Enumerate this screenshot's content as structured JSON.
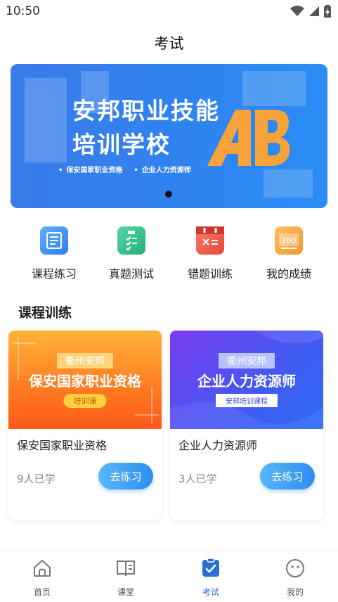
{
  "status_bar": {
    "time": "10:50"
  },
  "header": {
    "title": "考试"
  },
  "banner": {
    "title_line1": "安邦职业技能",
    "title_line2": "培训学校",
    "tags": [
      "保安国家职业资格",
      "企业人力资源师"
    ],
    "logo_icon": "ab-logo-icon"
  },
  "quick_actions": [
    {
      "label": "课程练习",
      "icon": "course-practice-icon",
      "color": "#3d8ef5"
    },
    {
      "label": "真题测试",
      "icon": "exam-checklist-icon",
      "color": "#2fc28a"
    },
    {
      "label": "错题训练",
      "icon": "wrong-question-calendar-icon",
      "color": "#ec5a4a"
    },
    {
      "label": "我的成绩",
      "icon": "score-100-icon",
      "color": "#f7a23a"
    }
  ],
  "section": {
    "title": "课程训练"
  },
  "courses": [
    {
      "image_tag": "衢州安邦",
      "image_title": "保安国家职业资格",
      "image_sub": "培训课",
      "name": "保安国家职业资格",
      "learners": "9人已学",
      "button": "去练习"
    },
    {
      "image_tag": "衢州安邦",
      "image_title": "企业人力资源师",
      "image_sub": "安邦培训课程",
      "name": "企业人力资源师",
      "learners": "3人已学",
      "button": "去练习"
    }
  ],
  "tabbar": {
    "items": [
      {
        "label": "首页",
        "icon": "home-icon"
      },
      {
        "label": "课堂",
        "icon": "book-icon"
      },
      {
        "label": "考试",
        "icon": "exam-check-icon"
      },
      {
        "label": "我的",
        "icon": "smiley-face-icon"
      }
    ],
    "active_color": "#2a6fd8"
  }
}
